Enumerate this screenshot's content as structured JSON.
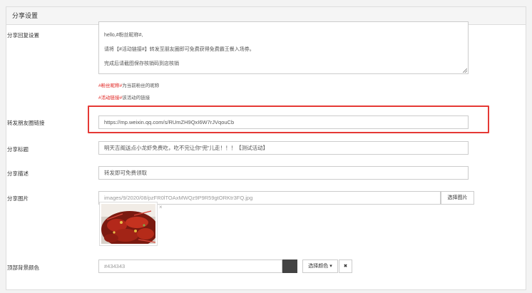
{
  "panel": {
    "title": "分享设置"
  },
  "reply": {
    "label": "分享回复设置",
    "value": "hello,#粉丝昵称#,\n\n请将【#活动链接#】转发至朋友圈即可免费获得免费霸王餐入场券。\n\n完成后请截图保存核销码到店核销",
    "help1_token": "#粉丝昵称#",
    "help1_text": "为当前粉丝的昵称",
    "help2_token": "#活动链接#",
    "help2_text": "该活动的链接"
  },
  "moments_link": {
    "label": "转发朋友圈链接",
    "value": "https://mp.weixin.qq.com/s/RUmZH9QxI6W7rJVqouCb"
  },
  "share_title": {
    "label": "分享标题",
    "value": "明天吉阁送点小龙虾免费吃，吃不完让你“兜”儿走！！！【测试活动】"
  },
  "share_desc": {
    "label": "分享描述",
    "value": "转发即可免费领取"
  },
  "share_image": {
    "label": "分享图片",
    "path": "images/9/2020/08/pzFR0lTOAxMWQz9P9R59gtORKtr3FQ.jpg",
    "button": "选择图片",
    "close": "×"
  },
  "top_bg": {
    "label": "顶部背景颜色",
    "value": "#434343",
    "button": "选择颜色 ▾",
    "clear": "✖",
    "swatch_color": "#434343"
  },
  "colors": {
    "highlight": "#e53935",
    "help_red": "#e0201d"
  }
}
